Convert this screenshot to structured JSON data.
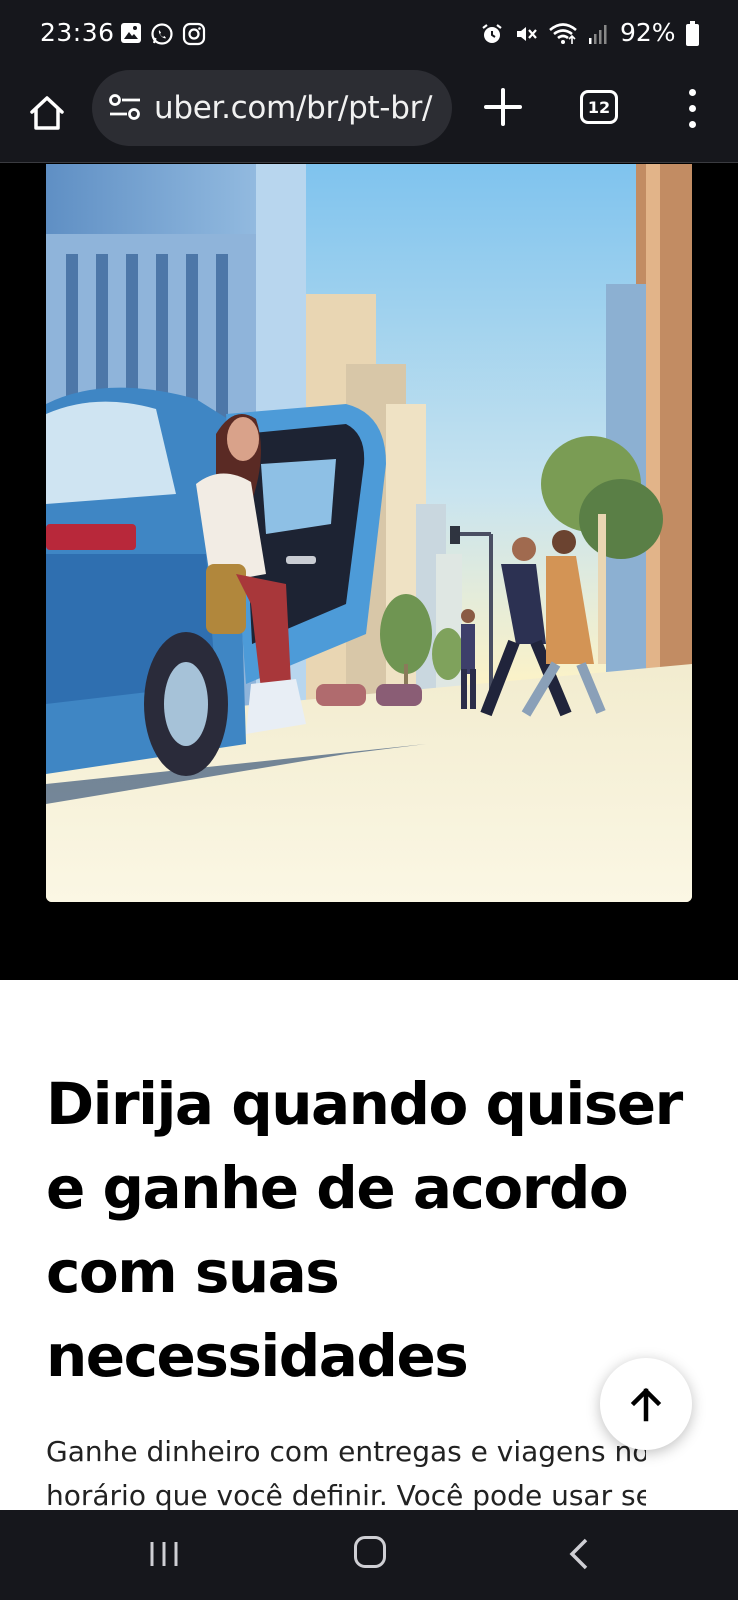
{
  "status_bar": {
    "time": "23:36",
    "battery": "92%",
    "left_icons": [
      "gallery-icon",
      "whatsapp-icon",
      "instagram-icon"
    ],
    "right_icons": [
      "alarm-icon",
      "mute-icon",
      "wifi-icon",
      "signal-icon",
      "battery-icon"
    ]
  },
  "browser": {
    "url": "uber.com/br/pt-br/",
    "tab_count": "12",
    "icons": [
      "home-icon",
      "site-settings-icon",
      "new-tab-icon",
      "tab-switcher-icon",
      "more-menu-icon"
    ]
  },
  "hero": {
    "illustration": "Woman stepping out of a blue car on a sunny city street while pedestrians walk past"
  },
  "content": {
    "headline": "Dirija quando quiser e ganhe de acordo com suas necessidades",
    "body_line_1": "Ganhe dinheiro com entregas e viagens no",
    "body_line_2": "horário que você definir. Você pode usar seu"
  },
  "nav_bar": {
    "buttons": [
      "recents-button",
      "home-button",
      "back-button"
    ]
  },
  "colors": {
    "system_bar": "#16171c",
    "url_pill": "#2c2d33",
    "content_bg": "#ffffff",
    "text": "#000000"
  }
}
